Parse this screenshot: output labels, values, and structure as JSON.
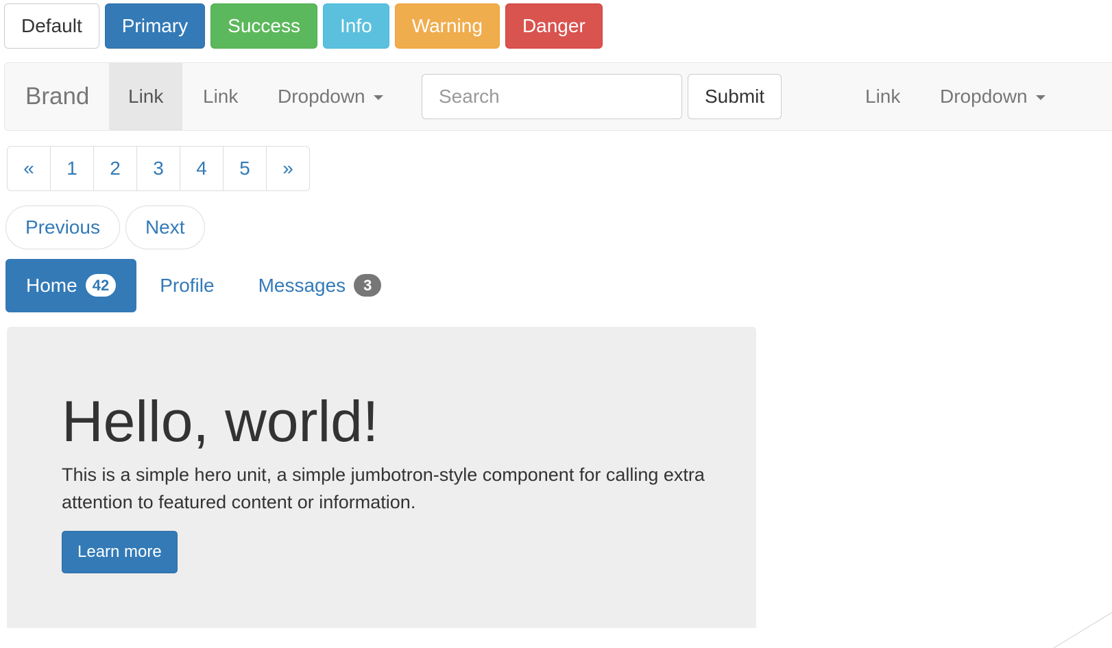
{
  "buttons": {
    "default": "Default",
    "primary": "Primary",
    "success": "Success",
    "info": "Info",
    "warning": "Warning",
    "danger": "Danger"
  },
  "navbar": {
    "brand": "Brand",
    "left_links": [
      "Link",
      "Link"
    ],
    "left_dropdown": "Dropdown",
    "search_placeholder": "Search",
    "submit": "Submit",
    "right_link": "Link",
    "right_dropdown": "Dropdown"
  },
  "pagination": {
    "prev": "«",
    "pages": [
      "1",
      "2",
      "3",
      "4",
      "5"
    ],
    "next": "»"
  },
  "pager": {
    "previous": "Previous",
    "next": "Next"
  },
  "pills": [
    {
      "label": "Home",
      "badge": "42",
      "active": true
    },
    {
      "label": "Profile",
      "badge": "",
      "active": false
    },
    {
      "label": "Messages",
      "badge": "3",
      "active": false
    }
  ],
  "jumbotron": {
    "title": "Hello, world!",
    "text": "This is a simple hero unit, a simple jumbotron-style component for calling extra attention to featured content or information.",
    "button": "Learn more"
  },
  "colors": {
    "primary": "#337ab7",
    "success": "#5cb85c",
    "info": "#5bc0de",
    "warning": "#f0ad4e",
    "danger": "#d9534f"
  },
  "icons": [
    "caret-down-icon",
    "caret-down-icon"
  ]
}
